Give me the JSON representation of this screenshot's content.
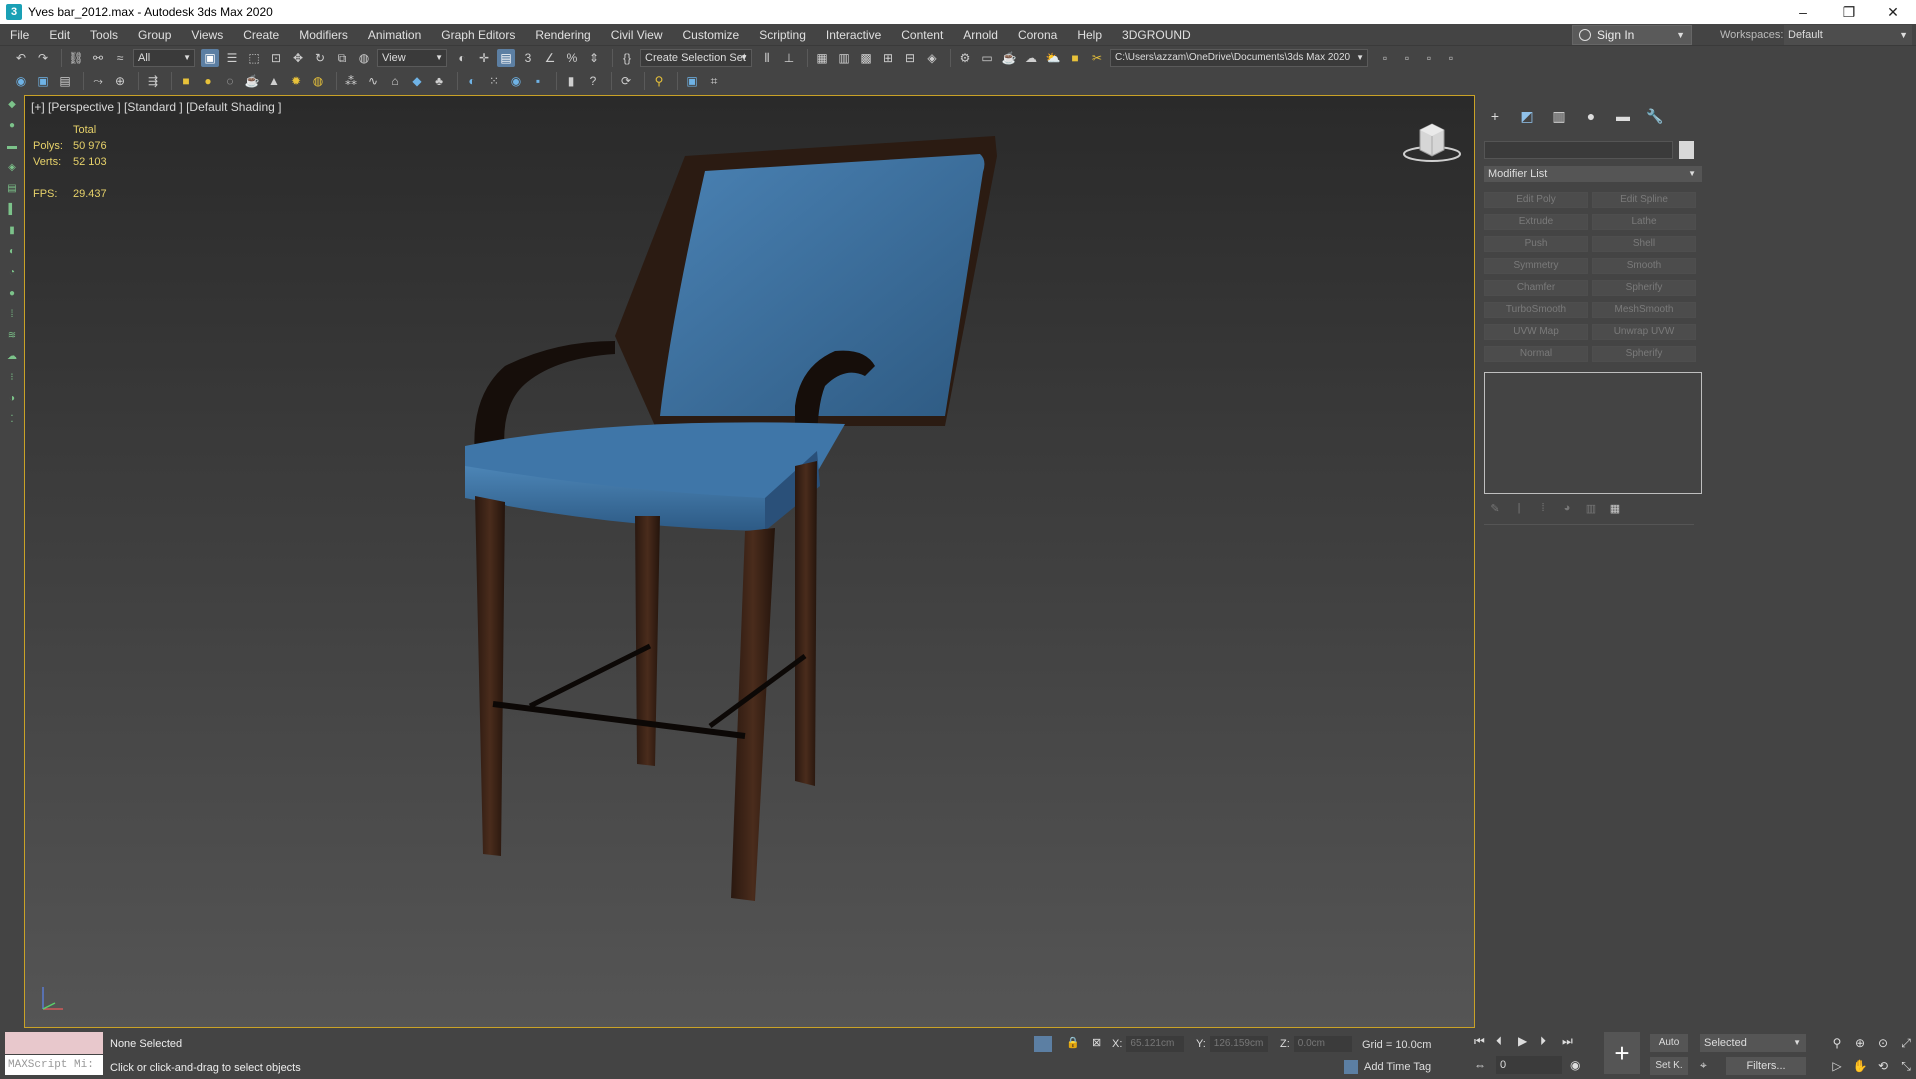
{
  "window": {
    "title": "Yves bar_2012.max - Autodesk 3ds Max 2020",
    "app_icon": "3",
    "minimize": "–",
    "restore": "❐",
    "close": "✕"
  },
  "menu": [
    "File",
    "Edit",
    "Tools",
    "Group",
    "Views",
    "Create",
    "Modifiers",
    "Animation",
    "Graph Editors",
    "Rendering",
    "Civil View",
    "Customize",
    "Scripting",
    "Interactive",
    "Content",
    "Arnold",
    "Corona",
    "Help",
    "3DGROUND"
  ],
  "account": {
    "sign_in": "Sign In",
    "workspaces_label": "Workspaces:",
    "workspace": "Default"
  },
  "toolbar1": {
    "filter": "All",
    "ref_coord": "View",
    "selection_set": "Create Selection Set",
    "project_path": "C:\\Users\\azzam\\OneDrive\\Documents\\3ds Max 2020"
  },
  "viewport": {
    "label": "[+] [Perspective ] [Standard ] [Default Shading ]",
    "stats_header": "Total",
    "polys_label": "Polys:",
    "polys": "50 976",
    "verts_label": "Verts:",
    "verts": "52 103",
    "fps_label": "FPS:",
    "fps": "29.437"
  },
  "command_panel": {
    "modifier_list": "Modifier List",
    "modifiers": [
      "Edit Poly",
      "Edit Spline",
      "Extrude",
      "Lathe",
      "Push",
      "Shell",
      "Symmetry",
      "Smooth",
      "Chamfer",
      "Spherify",
      "TurboSmooth",
      "MeshSmooth",
      "UVW Map",
      "Unwrap UVW",
      "Normal",
      "Spherify"
    ]
  },
  "status": {
    "maxscript": "MAXScript Mi:",
    "selection": "None Selected",
    "prompt": "Click or click-and-drag to select objects",
    "x_label": "X:",
    "x_value": "65.121cm",
    "y_label": "Y:",
    "y_value": "126.159cm",
    "z_label": "Z:",
    "z_value": "0.0cm",
    "grid": "Grid = 10.0cm",
    "add_time_tag": "Add Time Tag",
    "frame": "0",
    "auto": "Auto",
    "set_key": "Set K.",
    "selected": "Selected",
    "filters": "Filters..."
  },
  "colors": {
    "accent": "#c9a227",
    "seat_blue": "#3a6e9e",
    "wood": "#3b2417"
  }
}
